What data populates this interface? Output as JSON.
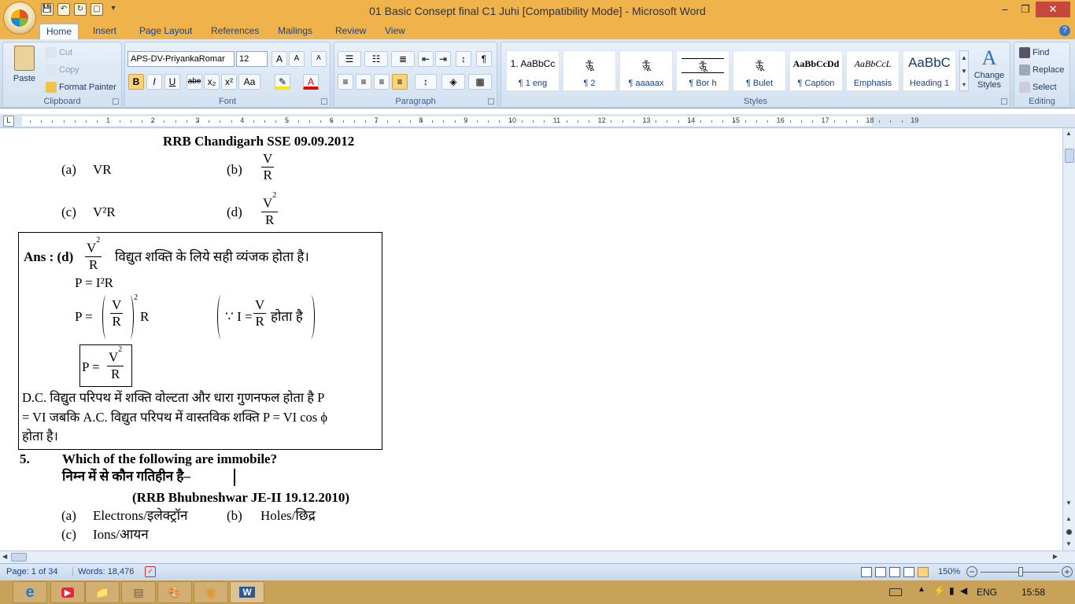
{
  "window": {
    "title": "01 Basic Consept final C1 Juhi [Compatibility Mode] - Microsoft Word",
    "min": "–",
    "max": "❐",
    "close": "✕"
  },
  "qat": {
    "save": "💾",
    "undo": "↶",
    "redo": "↻",
    "new": "▢",
    "more": "▾"
  },
  "tabs": [
    "Home",
    "Insert",
    "Page Layout",
    "References",
    "Mailings",
    "Review",
    "View"
  ],
  "clipboard": {
    "paste": "Paste",
    "cut": "Cut",
    "copy": "Copy",
    "painter": "Format Painter",
    "label": "Clipboard"
  },
  "font": {
    "name": "APS-DV-PriyankaRomar",
    "size": "12",
    "label": "Font",
    "buttons": [
      "B",
      "I",
      "U",
      "abe",
      "x₂",
      "x²",
      "Aa"
    ]
  },
  "paragraph": {
    "label": "Paragraph"
  },
  "styles": {
    "label": "Styles",
    "items": [
      {
        "sample": "1. AaBbCc",
        "name": "¶ 1 eng"
      },
      {
        "sample": "ऊ़ूँ",
        "name": "¶ 2"
      },
      {
        "sample": "ऊ़ूँ",
        "name": "¶ aaaaax"
      },
      {
        "sample": "ऊ़ूँ",
        "name": "¶ Bor h"
      },
      {
        "sample": "ऊ़ूँ",
        "name": "¶ Bulet"
      },
      {
        "sample": "AaBbCcDd",
        "name": "¶ Caption"
      },
      {
        "sample": "AaBbCcL",
        "name": "Emphasis"
      },
      {
        "sample": "AaBbC",
        "name": "Heading 1"
      }
    ],
    "change": "Change Styles"
  },
  "editing": {
    "find": "Find",
    "replace": "Replace",
    "select": "Select",
    "label": "Editing"
  },
  "ruler": {
    "numbers": [
      "1",
      "2",
      "3",
      "4",
      "5",
      "6",
      "7",
      "8",
      "9",
      "10",
      "11",
      "12",
      "13",
      "14",
      "15",
      "16",
      "17",
      "18",
      "19"
    ]
  },
  "doc": {
    "source1": "RRB Chandigarh SSE 09.09.2012",
    "optA_label": "(a)",
    "optA": "VR",
    "optB_label": "(b)",
    "optC_label": "(c)",
    "optC": "V²R",
    "optD_label": "(d)",
    "V": "V",
    "R": "R",
    "V2": "V",
    "sq": "2",
    "ans": "Ans : (d)",
    "ans_text": "विद्युत शक्ति के लिये सही व्यंजक होता है।",
    "eq1": "P = I²R",
    "eq2_left": "P =",
    "eq2_R": "R",
    "because": "∵ I =",
    "hota": "होता है",
    "eq3_left": "P =",
    "para1": "D.C. विद्युत परिपथ में शक्ति वोल्टता और धारा गुणनफल होता है P",
    "para2": "= VI  जबकि  A.C. विद्युत परिपथ में वास्तविक  शक्ति P = VI cos ϕ",
    "para3": "होता है।",
    "q_num": "5.",
    "q_en": "Which of the following are immobile?",
    "q_hi": "निम्न में से कौन गतिहीन है–",
    "source2": "(RRB Bhubneshwar JE-II 19.12.2010)",
    "o1_label": "(a)",
    "o1": "Electrons/इलेक्ट्रॉन",
    "o2_label": "(b)",
    "o2": "Holes/छिद्र",
    "o3_label": "(c)",
    "o3": "Ions/आयन"
  },
  "status": {
    "page": "Page: 1 of 34",
    "words": "Words: 18,476",
    "zoom": "150%"
  },
  "tray": {
    "lang": "ENG",
    "time": "15:58"
  },
  "taskbar": [
    {
      "name": "ie",
      "glyph": "e"
    },
    {
      "name": "media",
      "glyph": "▶"
    },
    {
      "name": "explorer",
      "glyph": "📁"
    },
    {
      "name": "notepad",
      "glyph": "▤"
    },
    {
      "name": "paint",
      "glyph": "🎨"
    },
    {
      "name": "chrome",
      "glyph": "◉"
    },
    {
      "name": "word",
      "glyph": "W"
    }
  ]
}
